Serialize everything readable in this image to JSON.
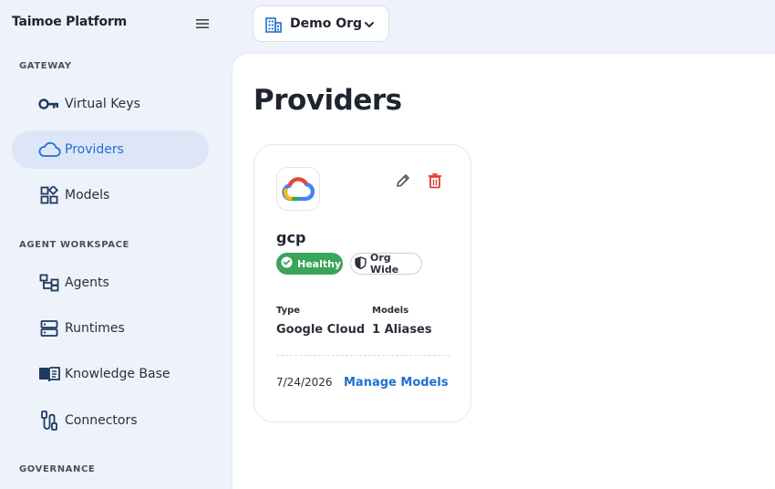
{
  "app": {
    "title": "Taimoe Platform"
  },
  "sidebar": {
    "sections": [
      {
        "label": "GATEWAY"
      },
      {
        "label": "AGENT WORKSPACE"
      },
      {
        "label": "GOVERNANCE"
      }
    ],
    "items": [
      {
        "label": "Virtual Keys",
        "icon": "key-icon"
      },
      {
        "label": "Providers",
        "icon": "cloud-icon",
        "active": true
      },
      {
        "label": "Models",
        "icon": "models-icon"
      },
      {
        "label": "Agents",
        "icon": "agents-icon"
      },
      {
        "label": "Runtimes",
        "icon": "server-icon"
      },
      {
        "label": "Knowledge Base",
        "icon": "book-icon"
      },
      {
        "label": "Connectors",
        "icon": "connector-icon"
      }
    ]
  },
  "org": {
    "name": "Demo Org",
    "icon": "building-icon"
  },
  "page": {
    "title": "Providers"
  },
  "provider": {
    "name": "gcp",
    "logo": "google-cloud-logo",
    "status": "Healthy",
    "scope": "Org Wide",
    "type_label": "Type",
    "type_value": "Google Cloud",
    "models_label": "Models",
    "models_value": "1 Aliases",
    "date": "7/24/2026",
    "manage_label": "Manage Models"
  },
  "colors": {
    "accent": "#1f6fd1",
    "healthy": "#3aa55a",
    "danger": "#e53935",
    "sidebar_bg": "#eef2fa",
    "active_bg": "#dde6f6"
  }
}
